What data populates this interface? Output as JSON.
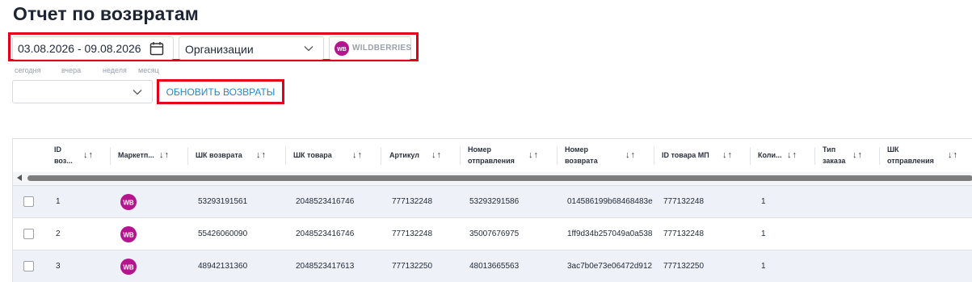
{
  "title": "Отчет по возвратам",
  "filters": {
    "date_range": "03.08.2026 - 09.08.2026",
    "organizations_label": "Организации",
    "marketplace_text": "WILDBERRIES",
    "marketplace_logo": "WB",
    "quick_ranges": [
      "сегодня",
      "вчера",
      "неделя",
      "месяц"
    ],
    "period_value": "",
    "refresh_label": "ОБНОВИТЬ ВОЗВРАТЫ"
  },
  "colors": {
    "highlight": "#e3001b",
    "accent": "#1f8ad2",
    "wb_brand": "#b5148f"
  },
  "icons": {
    "date": "calendar-icon",
    "select": "chevron-down-icon",
    "sort": "sort-arrows-icon",
    "marketplace": "wb-logo-icon"
  },
  "table": {
    "columns": [
      {
        "l1": "ID",
        "l2": "воз..."
      },
      {
        "l1": "Маркетп...",
        "l2": ""
      },
      {
        "l1": "ШК возврата",
        "l2": ""
      },
      {
        "l1": "ШК товара",
        "l2": ""
      },
      {
        "l1": "Артикул",
        "l2": ""
      },
      {
        "l1": "Номер",
        "l2": "отправления"
      },
      {
        "l1": "Номер",
        "l2": "возврата"
      },
      {
        "l1": "ID товара МП",
        "l2": ""
      },
      {
        "l1": "Коли...",
        "l2": ""
      },
      {
        "l1": "Тип",
        "l2": "заказа"
      },
      {
        "l1": "ШК",
        "l2": "отправления"
      }
    ],
    "sort_glyph": "↓↑",
    "rows": [
      {
        "id": "1",
        "marketplace": "WB",
        "return_barcode": "53293191561",
        "product_barcode": "2048523416746",
        "article": "777132248",
        "shipment_number": "53293291586",
        "return_number": "014586199b68468483e",
        "mp_product_id": "777132248",
        "quantity": "1"
      },
      {
        "id": "2",
        "marketplace": "WB",
        "return_barcode": "55426060090",
        "product_barcode": "2048523416746",
        "article": "777132248",
        "shipment_number": "35007676975",
        "return_number": "1ff9d34b257049a0a538",
        "mp_product_id": "777132248",
        "quantity": "1"
      },
      {
        "id": "3",
        "marketplace": "WB",
        "return_barcode": "48942131360",
        "product_barcode": "2048523417613",
        "article": "777132250",
        "shipment_number": "48013665563",
        "return_number": "3ac7b0e73e06472d912",
        "mp_product_id": "777132250",
        "quantity": "1"
      }
    ]
  }
}
